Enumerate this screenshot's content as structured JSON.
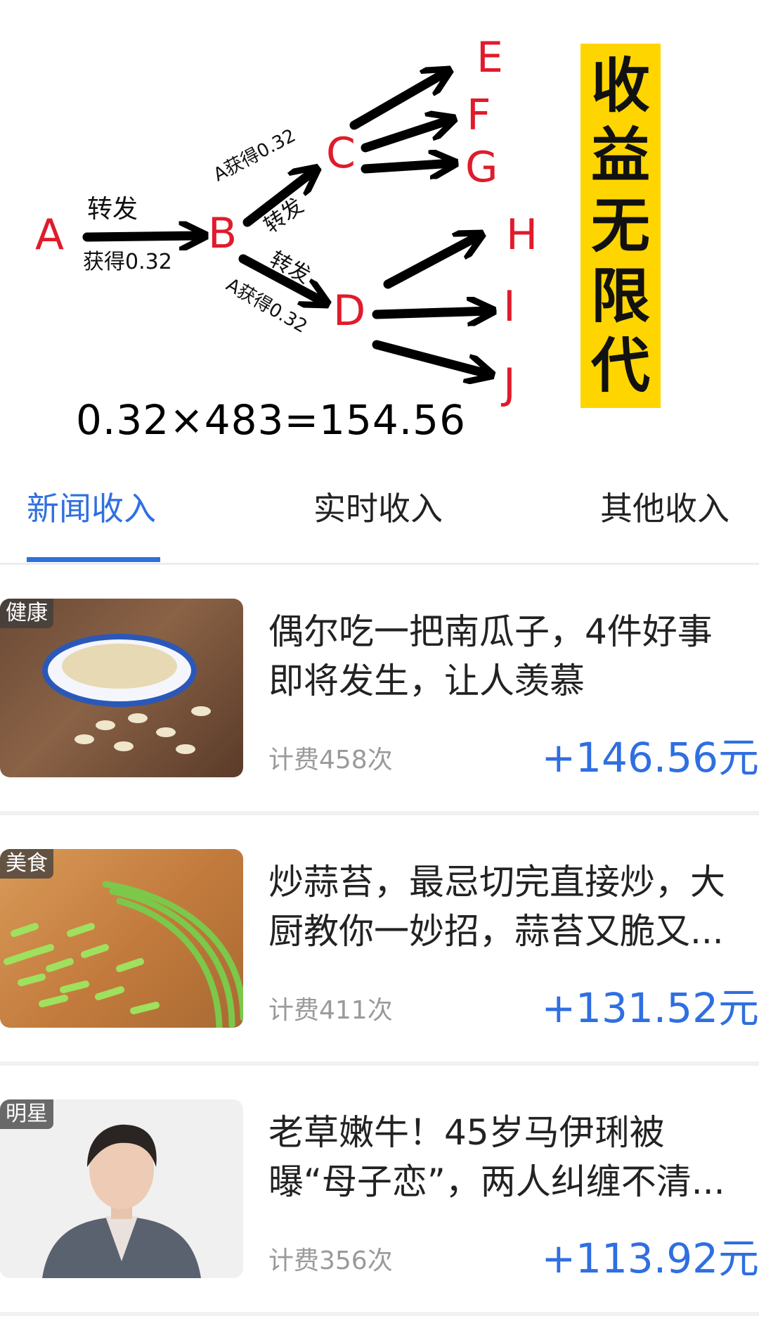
{
  "diagram": {
    "nodes": {
      "a": "A",
      "b": "B",
      "c": "C",
      "d": "D",
      "e": "E",
      "f": "F",
      "g": "G",
      "h": "H",
      "i": "I",
      "j": "J"
    },
    "labels": {
      "ab_top": "转发",
      "ab_bottom": "获得0.32",
      "bc_top": "A获得0.32",
      "bc_mid": "转发",
      "bd_top": "转发",
      "bd_bottom": "A获得0.32"
    },
    "formula": "0.32×483=154.56",
    "banner_chars": [
      "收",
      "益",
      "无",
      "限",
      "代"
    ]
  },
  "tabs": [
    {
      "label": "新闻收入",
      "active": true
    },
    {
      "label": "实时收入",
      "active": false
    },
    {
      "label": "其他收入",
      "active": false
    }
  ],
  "news": [
    {
      "tag": "健康",
      "title_line1": "偶尔吃一把南瓜子，4件好事",
      "title_line2": "即将发生，让人羡慕",
      "count": "计费458次",
      "amount": "+146.56元"
    },
    {
      "tag": "美食",
      "title_line1": "炒蒜苔，最忌切完直接炒，大",
      "title_line2": "厨教你一妙招，蒜苔又脆又...",
      "count": "计费411次",
      "amount": "+131.52元"
    },
    {
      "tag": "明星",
      "title_line1": "老草嫩牛！45岁马伊琍被",
      "title_line2": "曝“母子恋”，两人纠缠不清...",
      "count": "计费356次",
      "amount": "+113.92元"
    }
  ],
  "colors": {
    "accent": "#2f6fe0",
    "node": "#e01b2b",
    "banner": "#ffd500"
  }
}
